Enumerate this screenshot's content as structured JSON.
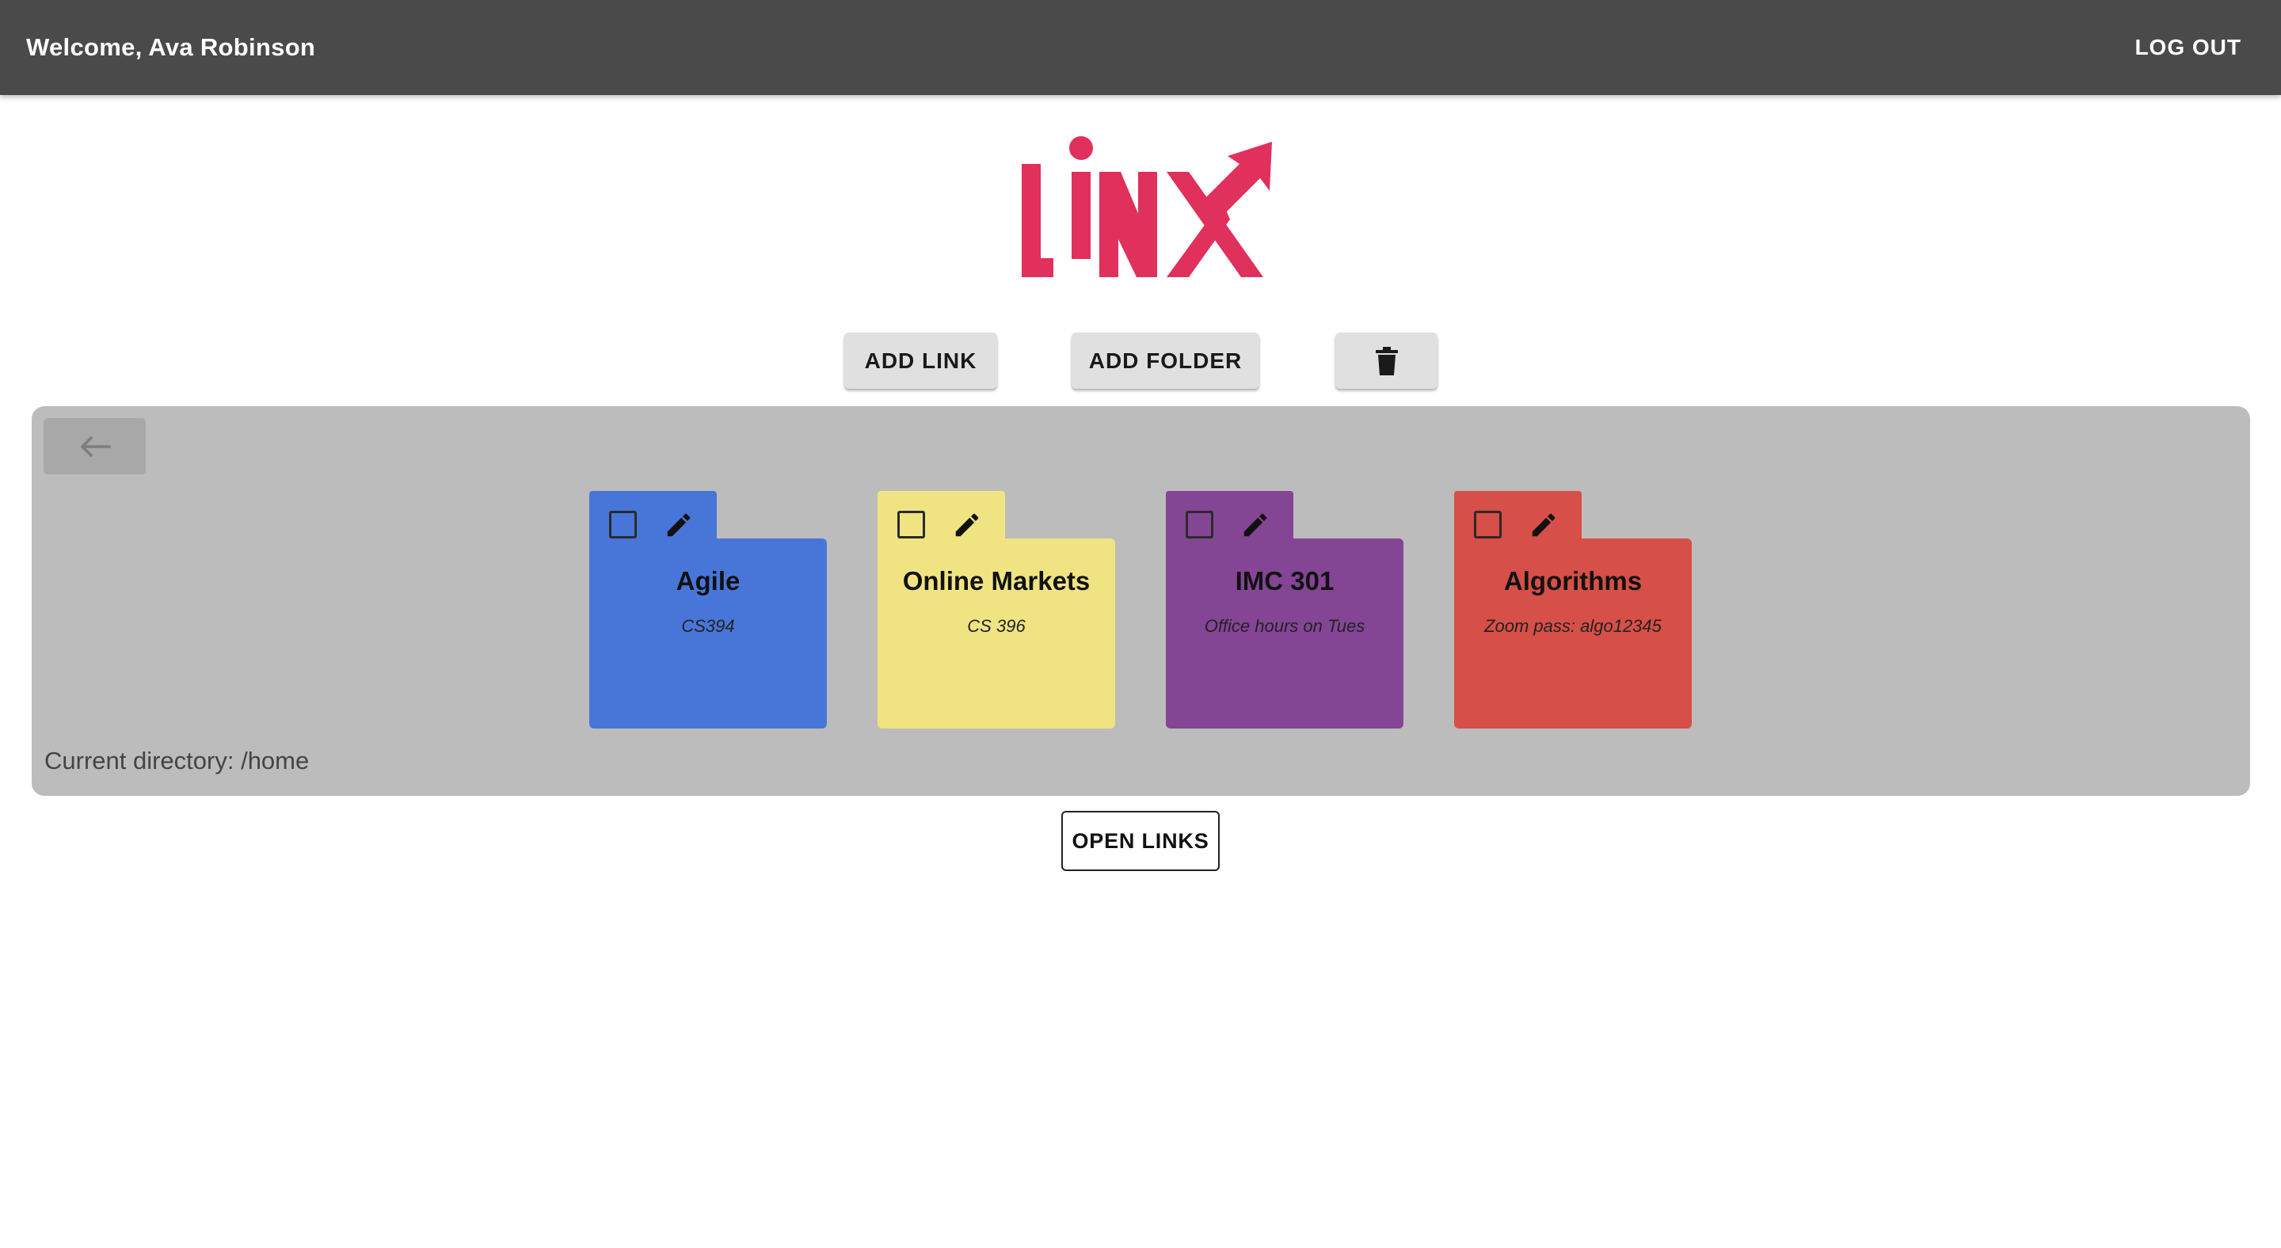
{
  "header": {
    "welcome": "Welcome, Ava Robinson",
    "logout_label": "LOG OUT"
  },
  "logo": {
    "text": "LINX",
    "color": "#e0305c"
  },
  "toolbar": {
    "add_link_label": "ADD LINK",
    "add_folder_label": "ADD FOLDER",
    "delete_icon": "trash-icon"
  },
  "panel": {
    "back_icon": "arrow-left-icon",
    "current_directory": "Current directory: /home"
  },
  "folders": [
    {
      "name": "Agile",
      "description": "CS394",
      "color": "#4876d8"
    },
    {
      "name": "Online Markets",
      "description": "CS 396",
      "color": "#f0e482"
    },
    {
      "name": "IMC 301",
      "description": "Office hours on Tues",
      "color": "#844595"
    },
    {
      "name": "Algorithms",
      "description": "Zoom pass: algo12345",
      "color": "#d64f48"
    }
  ],
  "open_links_label": "OPEN LINKS",
  "colors": {
    "topbar": "#4a4a4a",
    "panel": "#bcbcbc",
    "button": "#e0e0e0"
  }
}
